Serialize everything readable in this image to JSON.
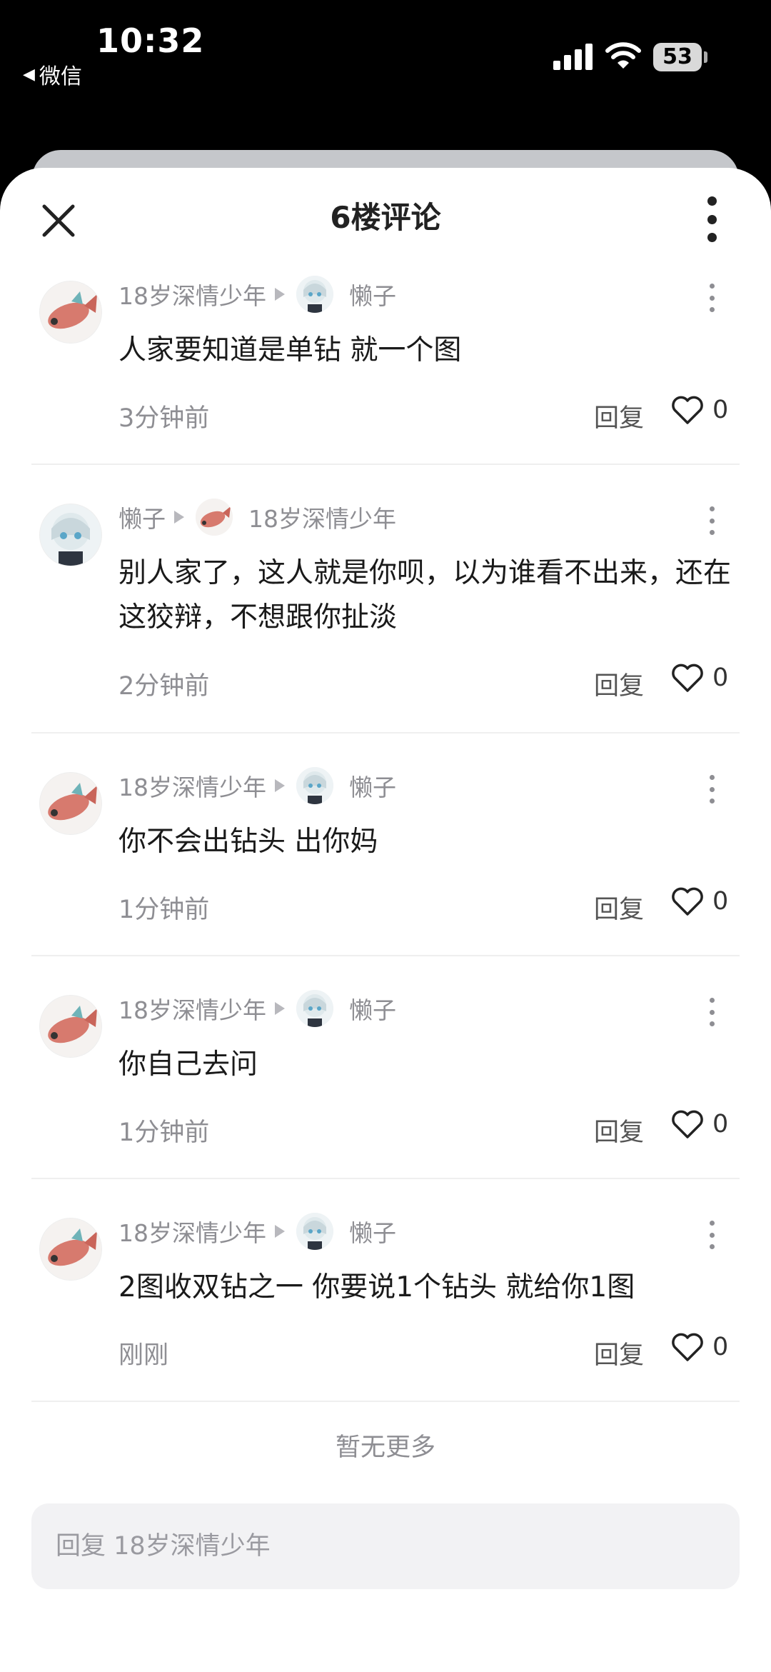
{
  "status_bar": {
    "time": "10:32",
    "back_app": "微信",
    "battery": "53"
  },
  "header": {
    "title": "6楼评论"
  },
  "comments": [
    {
      "author": "18岁深情少年",
      "author_avatar": "fish-avatar",
      "reply_to": "懒子",
      "reply_to_avatar": "anime-avatar",
      "text": "人家要知道是单钻  就一个图",
      "time": "3分钟前",
      "reply_label": "回复",
      "likes": "0"
    },
    {
      "author": "懒子",
      "author_avatar": "anime-avatar",
      "reply_to": "18岁深情少年",
      "reply_to_avatar": "fish-avatar",
      "text": "别人家了，这人就是你呗，以为谁看不出来，还在这狡辩，不想跟你扯淡",
      "time": "2分钟前",
      "reply_label": "回复",
      "likes": "0"
    },
    {
      "author": "18岁深情少年",
      "author_avatar": "fish-avatar",
      "reply_to": "懒子",
      "reply_to_avatar": "anime-avatar",
      "text": "你不会出钻头  出你妈",
      "time": "1分钟前",
      "reply_label": "回复",
      "likes": "0"
    },
    {
      "author": "18岁深情少年",
      "author_avatar": "fish-avatar",
      "reply_to": "懒子",
      "reply_to_avatar": "anime-avatar",
      "text": "你自己去问",
      "time": "1分钟前",
      "reply_label": "回复",
      "likes": "0"
    },
    {
      "author": "18岁深情少年",
      "author_avatar": "fish-avatar",
      "reply_to": "懒子",
      "reply_to_avatar": "anime-avatar",
      "text": "2图收双钻之一  你要说1个钻头  就给你1图",
      "time": "刚刚",
      "reply_label": "回复",
      "likes": "0"
    }
  ],
  "footer": {
    "no_more": "暂无更多",
    "reply_placeholder": "回复 18岁深情少年"
  },
  "colors": {
    "text": "#1a1a1a",
    "meta": "#8e8e93",
    "divider": "#efefef",
    "input_bg": "#f2f2f4"
  }
}
